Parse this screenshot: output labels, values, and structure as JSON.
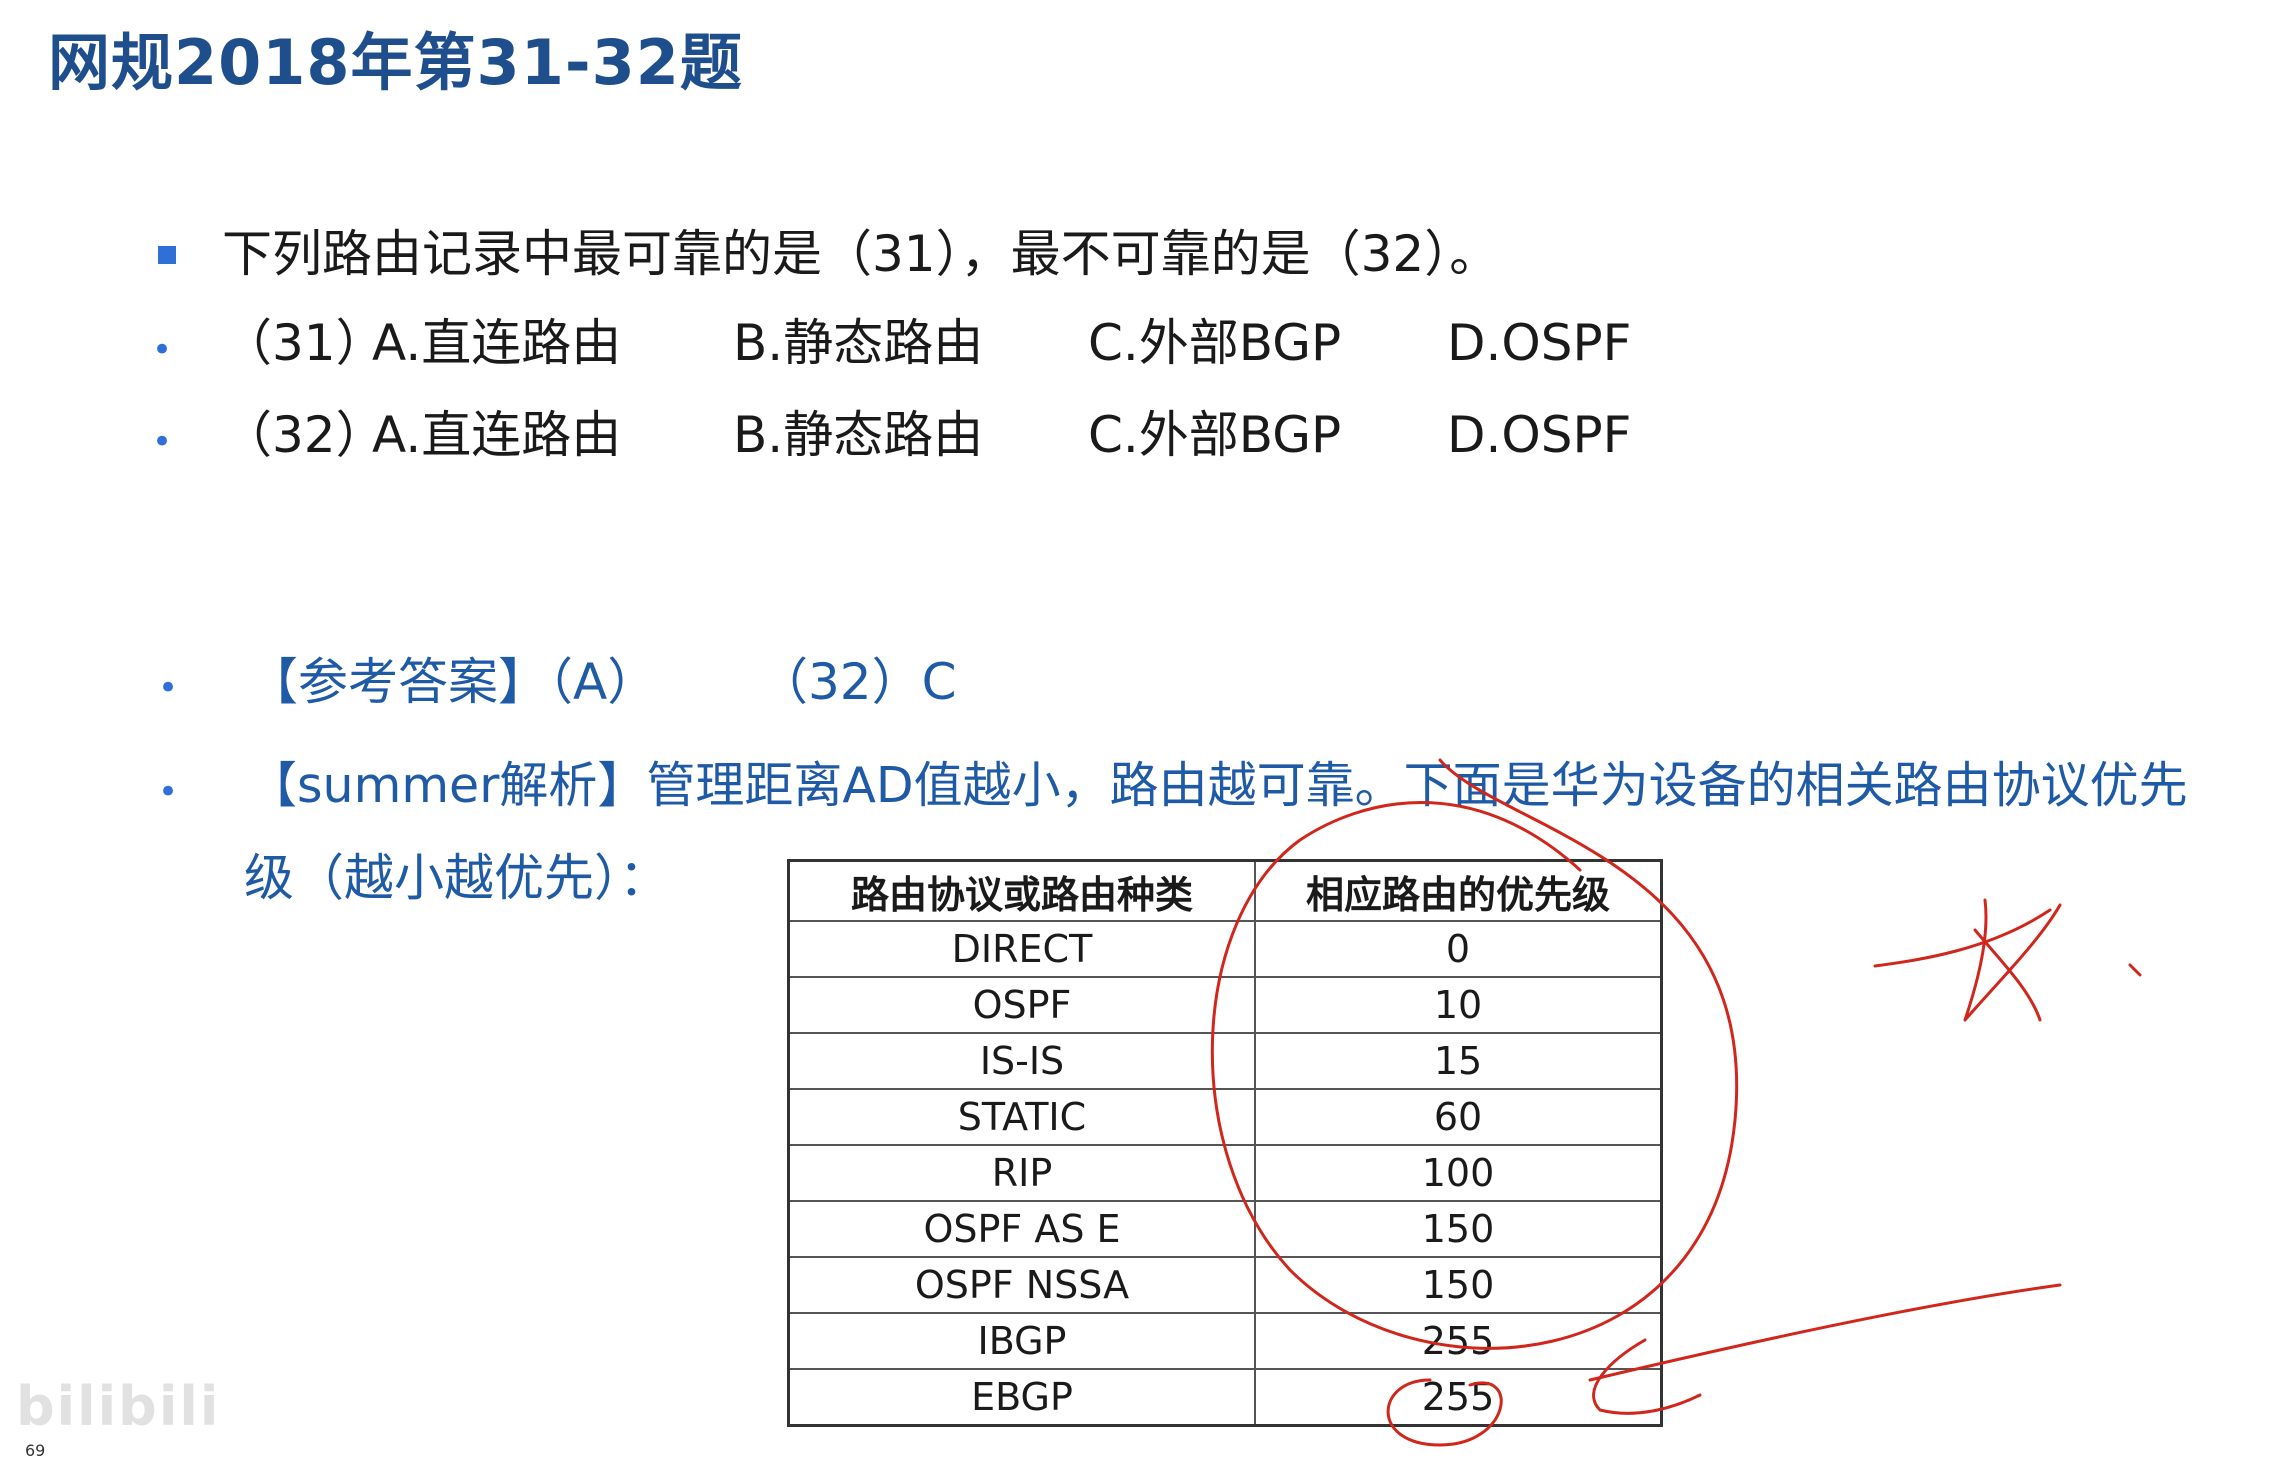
{
  "title": "网规2018年第31-32题",
  "question": "下列路由记录中最可靠的是（31），最不可靠的是（32）。",
  "q31": {
    "num": "（31）",
    "options": [
      "A.直连路由",
      "B.静态路由",
      "C.外部BGP",
      "D.OSPF"
    ]
  },
  "q32": {
    "num": "（32）",
    "options": [
      "A.直连路由",
      "B.静态路由",
      "C.外部BGP",
      "D.OSPF"
    ]
  },
  "answer": {
    "label": "【参考答案】（A）",
    "second": "（32）C"
  },
  "analysis": {
    "line1": "【summer解析】管理距离AD值越小，路由越可靠。下面是华为设备的相关路由协议优先",
    "line2": "级（越小越优先）："
  },
  "table": {
    "headers": [
      "路由协议或路由种类",
      "相应路由的优先级"
    ],
    "rows": [
      [
        "DIRECT",
        "0"
      ],
      [
        "OSPF",
        "10"
      ],
      [
        "IS-IS",
        "15"
      ],
      [
        "STATIC",
        "60"
      ],
      [
        "RIP",
        "100"
      ],
      [
        "OSPF AS E",
        "150"
      ],
      [
        "OSPF NSSA",
        "150"
      ],
      [
        "IBGP",
        "255"
      ],
      [
        "EBGP",
        "255"
      ]
    ]
  },
  "page_number": "69",
  "watermark": "bilibili",
  "colors": {
    "title": "#1f4e8c",
    "accent_blue": "#2f6fd6",
    "analysis_blue": "#1f5aa6",
    "annotation_red": "#d0261c"
  }
}
